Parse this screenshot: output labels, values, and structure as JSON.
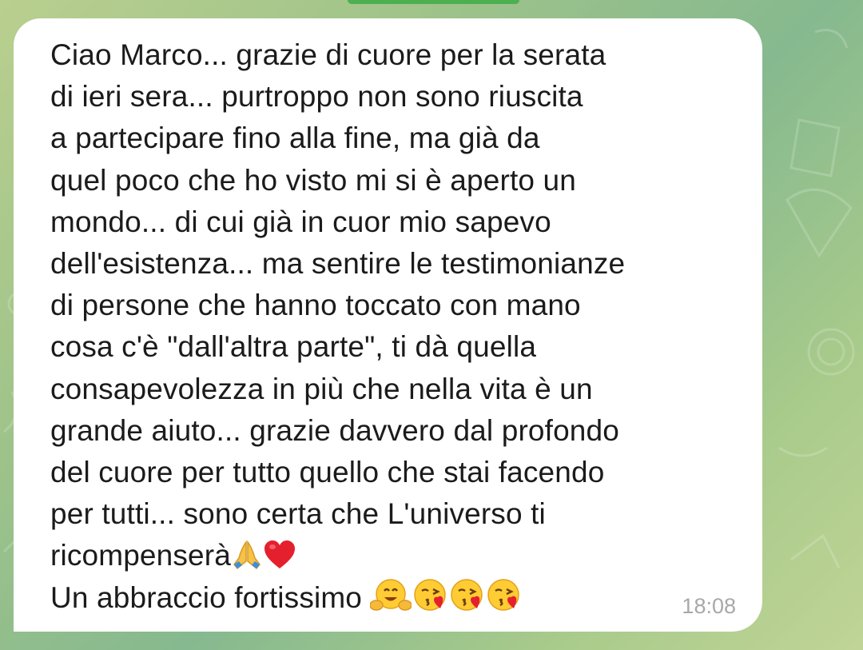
{
  "chat": {
    "background_color": "#a6c98c",
    "bubble_color": "#ffffff",
    "text_color": "#1b1b1b",
    "time_color": "#a8a8a8"
  },
  "message": {
    "lines": [
      "Ciao Marco... grazie di cuore per la serata",
      "di ieri sera... purtroppo non sono riuscita",
      "a partecipare fino alla fine, ma già da",
      "quel poco che ho visto mi si è aperto un",
      "mondo... di cui già in cuor mio sapevo",
      "dell'esistenza... ma sentire le testimonianze",
      "di persone che hanno toccato con mano",
      "cosa c'è \"dall'altra parte\", ti dà quella",
      "consapevolezza in più che nella vita è un",
      "grande aiuto... grazie davvero dal profondo",
      "del cuore per tutto quello che stai facendo",
      "per tutti... sono certa che L'universo ti"
    ],
    "line13": "ricompenserà",
    "line14": "Un abbraccio fortissimo ",
    "time": "18:08",
    "emojis": [
      "folded-hands-emoji",
      "red-heart-emoji",
      "hugging-face-emoji",
      "face-blowing-kiss-emoji",
      "face-blowing-kiss-emoji",
      "face-blowing-kiss-emoji"
    ]
  }
}
